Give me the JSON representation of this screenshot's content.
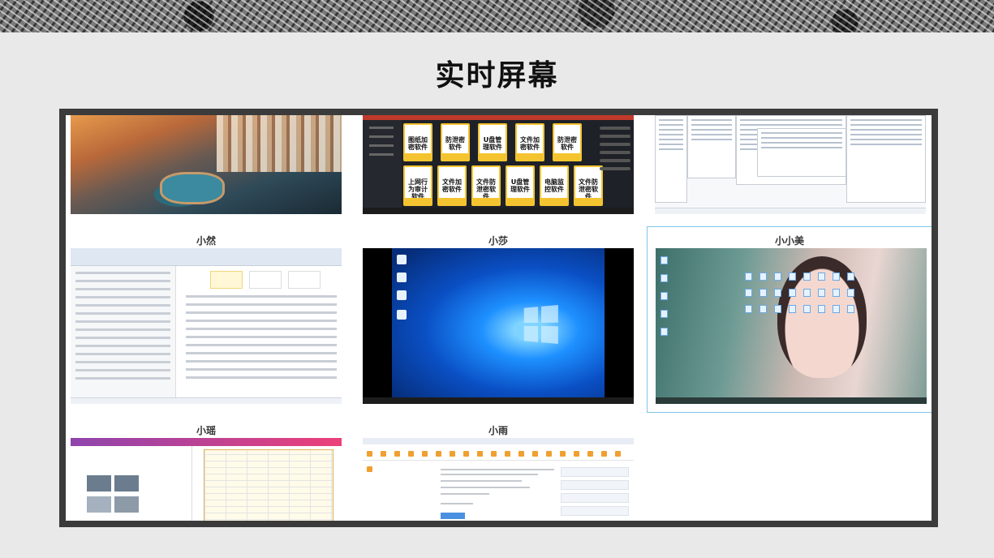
{
  "page": {
    "title": "实时屏幕"
  },
  "screens": [
    {
      "id": "s1",
      "label": ""
    },
    {
      "id": "s2",
      "label": ""
    },
    {
      "id": "s3",
      "label": ""
    },
    {
      "id": "s4",
      "label": "小然"
    },
    {
      "id": "s5",
      "label": "小莎"
    },
    {
      "id": "s6",
      "label": "小小美",
      "selected": true
    },
    {
      "id": "s7",
      "label": "小瑶"
    },
    {
      "id": "s8",
      "label": "小雨"
    }
  ],
  "posters": {
    "top_row": [
      "图纸加密软件",
      "防泄密软件",
      "U盘管理软件",
      "文件加密软件",
      "防泄密软件"
    ],
    "bottom_row": [
      "上网行为审计软件",
      "文件加密软件",
      "文件防泄密软件",
      "U盘管理软件",
      "电脑监控软件",
      "文件防泄密软件"
    ]
  },
  "colors": {
    "frame": "#3b3b3b",
    "background": "#e9e9e9",
    "selection": "#7fc4ea"
  }
}
